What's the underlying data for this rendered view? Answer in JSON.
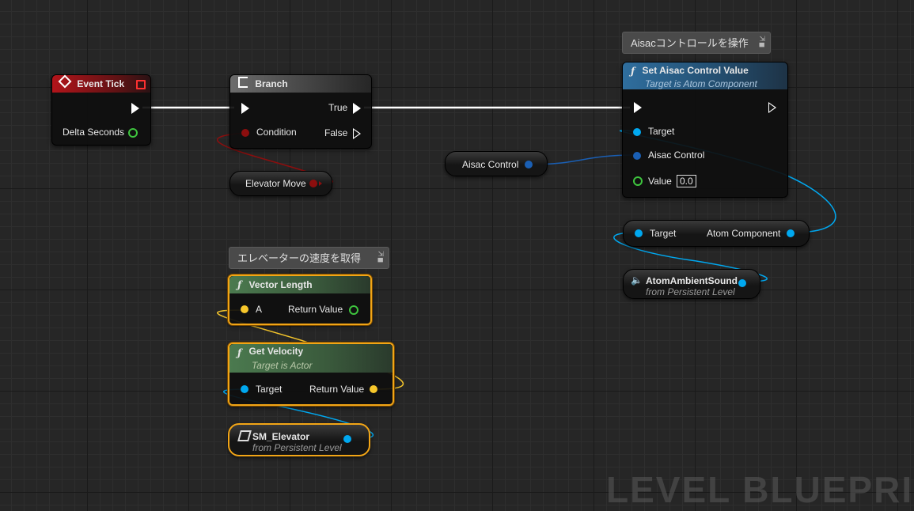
{
  "colors": {
    "exec": "#ffffff",
    "bool": "#8c0e0e",
    "float": "#3ec43e",
    "object": "#00a8f0",
    "vector": "#f7c72b",
    "selected": "#f2a516"
  },
  "event_tick": {
    "title": "Event Tick",
    "pin_delta": "Delta Seconds"
  },
  "branch": {
    "title": "Branch",
    "pin_true": "True",
    "pin_condition": "Condition",
    "pin_false": "False"
  },
  "elevator_move": {
    "label": "Elevator Move"
  },
  "aisac_control_var": {
    "label": "Aisac Control"
  },
  "comment_aisac": {
    "text": "Aisacコントロールを操作"
  },
  "set_aisac": {
    "title": "Set Aisac Control Value",
    "subtitle": "Target is Atom Component",
    "pin_target": "Target",
    "pin_aisac": "Aisac Control",
    "pin_value": "Value",
    "value": "0.0"
  },
  "atom_cast": {
    "pin_target": "Target",
    "pin_out": "Atom Component"
  },
  "atom_ambient": {
    "title": "AtomAmbientSound",
    "subtitle": "from Persistent Level"
  },
  "comment_speed": {
    "text": "エレベーターの速度を取得"
  },
  "vector_length": {
    "title": "Vector Length",
    "pin_a": "A",
    "pin_return": "Return Value"
  },
  "get_velocity": {
    "title": "Get Velocity",
    "subtitle": "Target is Actor",
    "pin_target": "Target",
    "pin_return": "Return Value"
  },
  "sm_elevator": {
    "title": "SM_Elevator",
    "subtitle": "from Persistent Level"
  },
  "watermark": "LEVEL BLUEPRI"
}
